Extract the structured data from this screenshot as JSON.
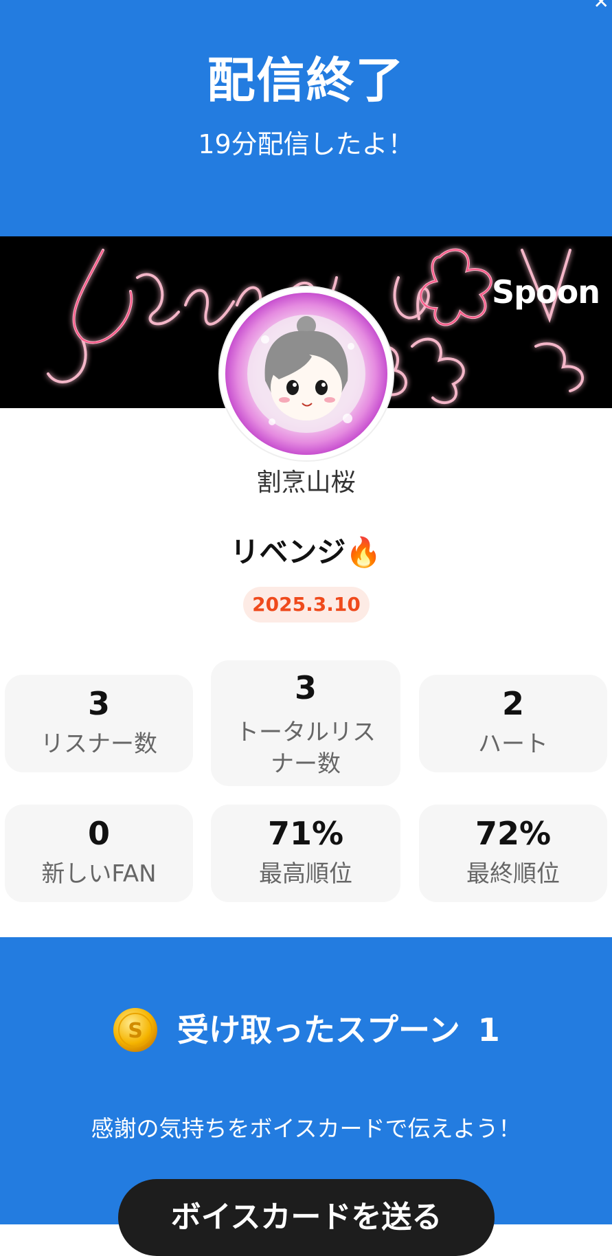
{
  "header": {
    "title": "配信終了",
    "subtitle": "19分配信したよ！",
    "background_color": "#237ce0"
  },
  "banner": {
    "logo": "Spoon",
    "background_color": "#000000",
    "decoration": "neon-pink-script-and-sakura"
  },
  "profile": {
    "avatar_icon": "avatar-icon",
    "username": "割烹山桜"
  },
  "broadcast": {
    "title": "リベンジ🔥",
    "date": "2025.3.10",
    "date_color": "#ef4a1c"
  },
  "stats": [
    {
      "value": "3",
      "label": "リスナー数"
    },
    {
      "value": "3",
      "label_line1": "トータルリス",
      "label_line2": "ナー数"
    },
    {
      "value": "2",
      "label": "ハート"
    },
    {
      "value": "0",
      "label": "新しいFAN"
    },
    {
      "value": "71%",
      "label": "最高順位"
    },
    {
      "value": "72%",
      "label": "最終順位"
    }
  ],
  "spoons": {
    "coin_icon": "spoon-coin-icon",
    "coin_letter": "S",
    "label": "受け取ったスプーン",
    "count": "1"
  },
  "voice_card": {
    "message": "感謝の気持ちをボイスカードで伝えよう！",
    "button_label": "ボイスカードを送る"
  }
}
